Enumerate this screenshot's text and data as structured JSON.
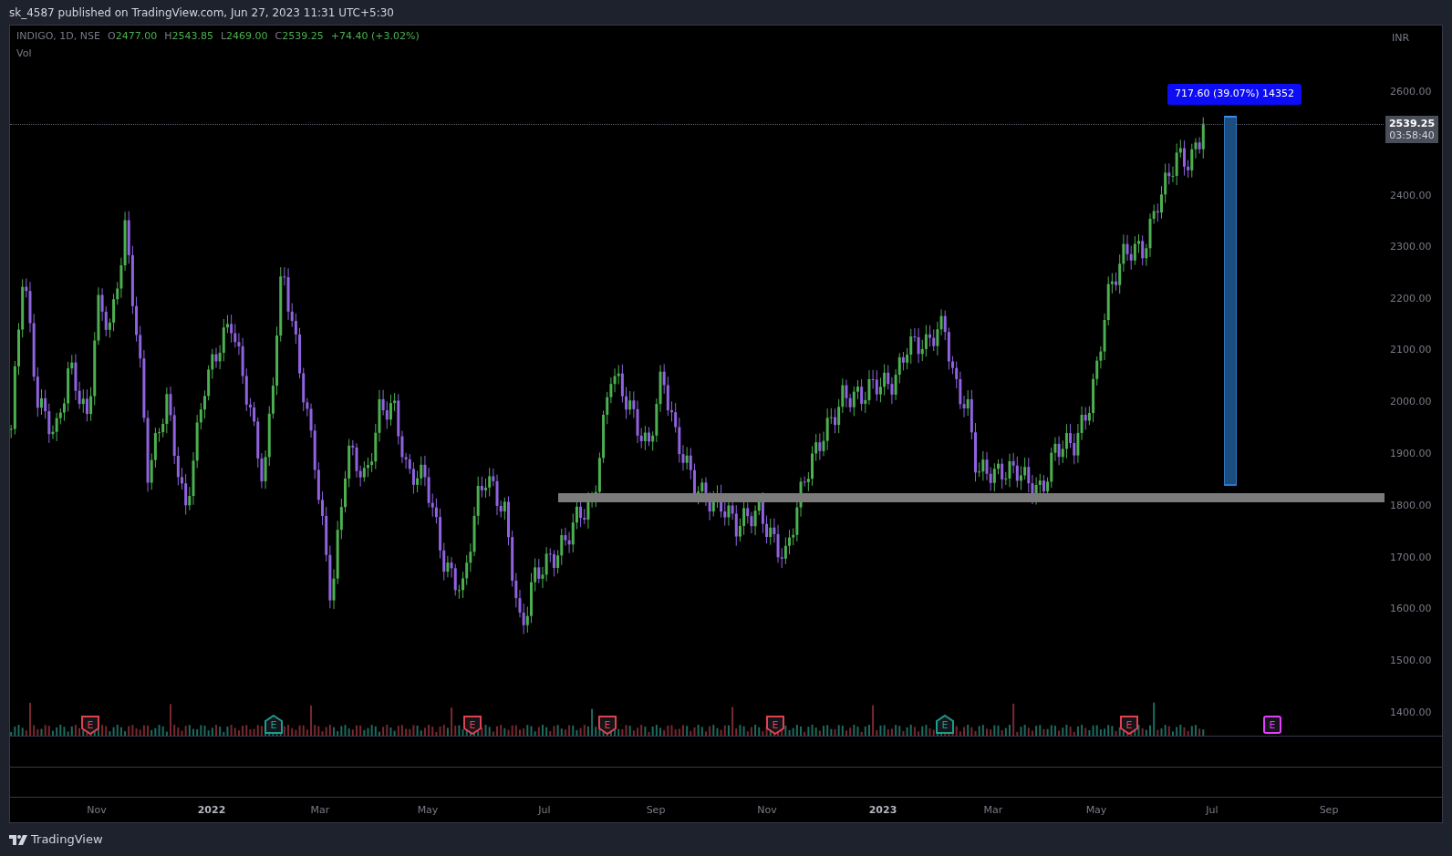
{
  "header": {
    "title": "sk_4587 published on TradingView.com, Jun 27, 2023 11:31 UTC+5:30"
  },
  "legend": {
    "symbol": "INDIGO, 1D, NSE",
    "positive": true,
    "ohlc": [
      {
        "label": "O",
        "value": "2477.00"
      },
      {
        "label": "H",
        "value": "2543.85"
      },
      {
        "label": "L",
        "value": "2469.00"
      },
      {
        "label": "C",
        "value": "2539.25"
      }
    ],
    "change": "+74.40 (+3.02%)",
    "volume_label": "Vol"
  },
  "currency": "INR",
  "price_axis": [
    "2600.00",
    "2400.00",
    "2300.00",
    "2200.00",
    "2100.00",
    "2000.00",
    "1900.00",
    "1800.00",
    "1700.00",
    "1600.00",
    "1500.00",
    "1400.00"
  ],
  "last_price": {
    "price": "2539.25",
    "countdown": "03:58:40"
  },
  "measure": {
    "label": "717.60 (39.07%) 14352"
  },
  "earnings": [
    {
      "kind": "down",
      "text": "E",
      "color": "#e0414f"
    },
    {
      "kind": "up",
      "text": "E",
      "color": "#1e9c8c"
    },
    {
      "kind": "down",
      "text": "E",
      "color": "#e0414f"
    },
    {
      "kind": "down",
      "text": "E",
      "color": "#e0414f"
    },
    {
      "kind": "down",
      "text": "E",
      "color": "#e0414f"
    },
    {
      "kind": "up",
      "text": "E",
      "color": "#1e9c8c"
    },
    {
      "kind": "down",
      "text": "E",
      "color": "#e0414f"
    },
    {
      "kind": "future",
      "text": "E",
      "color": "#e040fb"
    }
  ],
  "time_axis": [
    {
      "label": "Nov",
      "kind": "month"
    },
    {
      "label": "2022",
      "kind": "year"
    },
    {
      "label": "Mar",
      "kind": "month"
    },
    {
      "label": "May",
      "kind": "month"
    },
    {
      "label": "Jul",
      "kind": "month"
    },
    {
      "label": "Sep",
      "kind": "month"
    },
    {
      "label": "Nov",
      "kind": "month"
    },
    {
      "label": "2023",
      "kind": "year"
    },
    {
      "label": "Mar",
      "kind": "month"
    },
    {
      "label": "May",
      "kind": "month"
    },
    {
      "label": "Jul",
      "kind": "month"
    },
    {
      "label": "Sep",
      "kind": "month"
    }
  ],
  "footer": {
    "brand": "TradingView"
  }
}
